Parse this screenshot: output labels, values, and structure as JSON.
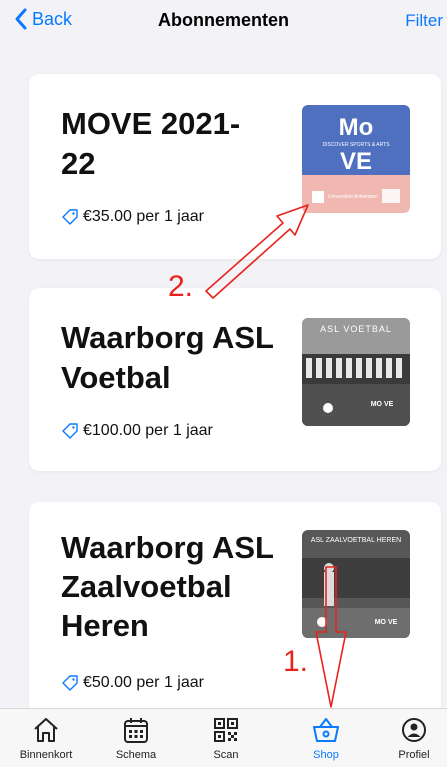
{
  "header": {
    "back_label": "Back",
    "title": "Abonnementen",
    "filter_label": "Filter"
  },
  "cards": [
    {
      "title_lines": [
        "MOVE 2021-",
        "22"
      ],
      "price": "€35.00 per 1 jaar",
      "thumb_text": {
        "mo": "Mo",
        "tagline": "DISCOVER SPORTS & ARTS",
        "ve": "VE",
        "uni": "Universiteit Antwerpen"
      }
    },
    {
      "title_lines": [
        "Waarborg ASL",
        "Voetbal"
      ],
      "price": "€100.00 per 1 jaar",
      "thumb_text": {
        "banner": "ASL VOETBAL",
        "logo": "MO VE"
      }
    },
    {
      "title_lines": [
        "Waarborg ASL",
        "Zaalvoetbal",
        "Heren"
      ],
      "price": "€50.00 per 1 jaar",
      "thumb_text": {
        "banner": "ASL ZAALVOETBAL HEREN",
        "logo": "MO VE"
      }
    }
  ],
  "annotations": {
    "label_1": "1.",
    "label_2": "2.",
    "color": "#e8231c"
  },
  "tabbar": {
    "items": [
      {
        "label": "Binnenkort",
        "icon": "home-icon"
      },
      {
        "label": "Schema",
        "icon": "calendar-icon"
      },
      {
        "label": "Scan",
        "icon": "qr-code-icon"
      },
      {
        "label": "Shop",
        "icon": "basket-icon",
        "active": true
      },
      {
        "label": "Profiel",
        "icon": "profile-icon"
      }
    ]
  },
  "colors": {
    "accent": "#0a7aff",
    "move_blue": "#4f6fbf",
    "move_pink": "#f0b8b0"
  }
}
